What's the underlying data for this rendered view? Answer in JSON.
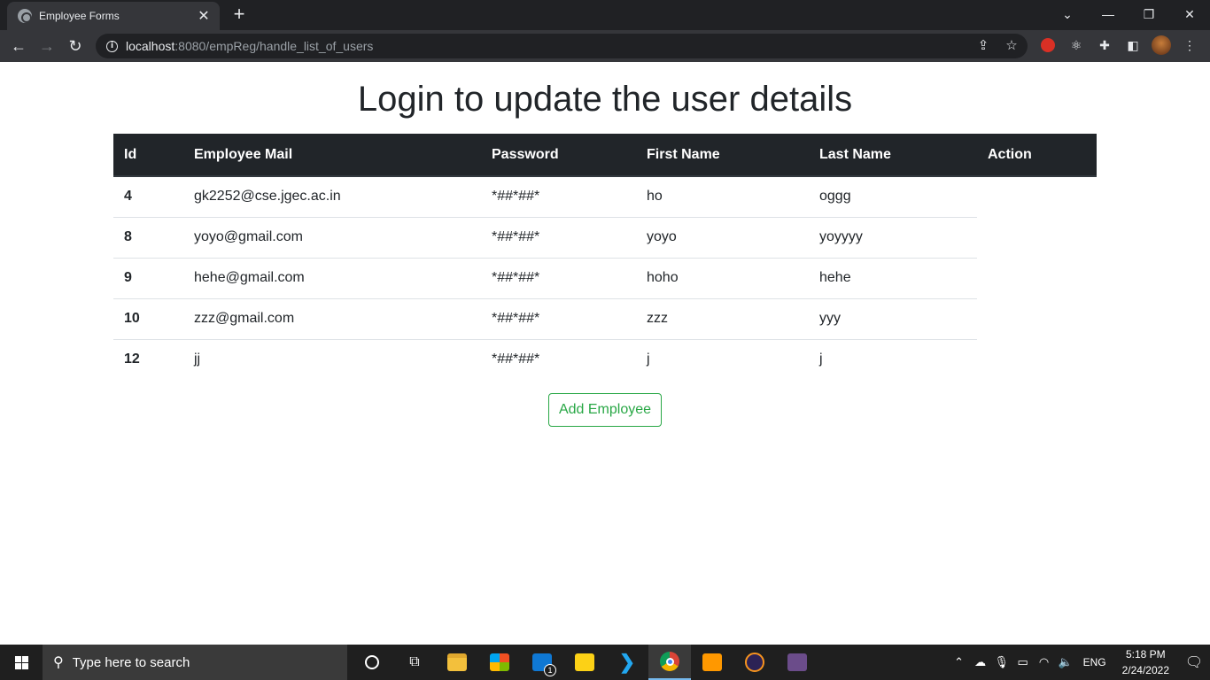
{
  "browser": {
    "tab_title": "Employee Forms",
    "tab_close": "✕",
    "new_tab": "+",
    "url_host": "localhost",
    "url_rest": ":8080/empReg/handle_list_of_users"
  },
  "page": {
    "title": "Login to update the user details",
    "table": {
      "headers": [
        "Id",
        "Employee Mail",
        "Password",
        "First Name",
        "Last Name",
        "Action"
      ],
      "rows": [
        {
          "id": "4",
          "email": "gk2252@cse.jgec.ac.in",
          "password": "*##*##*",
          "first_name": "ho",
          "last_name": "oggg"
        },
        {
          "id": "8",
          "email": "yoyo@gmail.com",
          "password": "*##*##*",
          "first_name": "yoyo",
          "last_name": "yoyyyy"
        },
        {
          "id": "9",
          "email": "hehe@gmail.com",
          "password": "*##*##*",
          "first_name": "hoho",
          "last_name": "hehe"
        },
        {
          "id": "10",
          "email": "zzz@gmail.com",
          "password": "*##*##*",
          "first_name": "zzz",
          "last_name": "yyy"
        },
        {
          "id": "12",
          "email": "jj",
          "password": "*##*##*",
          "first_name": "j",
          "last_name": "j"
        }
      ]
    },
    "add_button": "Add Employee"
  },
  "taskbar": {
    "search_placeholder": "Type here to search",
    "language": "ENG",
    "time": "5:18 PM",
    "date": "2/24/2022",
    "mail_badge": "1"
  },
  "colors": {
    "accent_green": "#28a745",
    "table_header": "#212529",
    "chrome_dark": "#202124"
  }
}
